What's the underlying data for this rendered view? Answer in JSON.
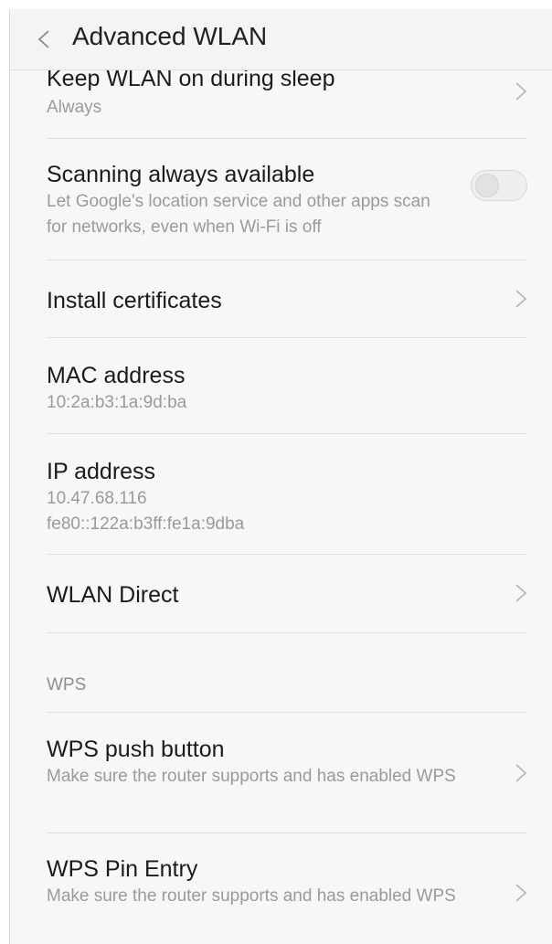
{
  "header": {
    "title": "Advanced WLAN",
    "back_icon": "chevron-left-icon"
  },
  "items": {
    "keep_wlan": {
      "title": "Keep WLAN on during sleep",
      "value": "Always"
    },
    "scanning": {
      "title": "Scanning always available",
      "description": "Let Google's location service and other apps scan for networks, even when Wi-Fi is off",
      "toggle_on": false
    },
    "install_certificates": {
      "title": "Install certificates"
    },
    "mac_address": {
      "title": "MAC address",
      "value": "10:2a:b3:1a:9d:ba"
    },
    "ip_address": {
      "title": "IP address",
      "value_ipv4": "10.47.68.116",
      "value_ipv6": "fe80::122a:b3ff:fe1a:9dba"
    },
    "wlan_direct": {
      "title": "WLAN Direct"
    },
    "wps_section": {
      "label": "WPS"
    },
    "wps_push": {
      "title": "WPS push button",
      "description": "Make sure the router supports and has enabled WPS"
    },
    "wps_pin": {
      "title": "WPS Pin Entry",
      "description": "Make sure the router supports and has enabled WPS"
    }
  },
  "colors": {
    "background": "#f7f7f7",
    "title_text": "#1b1b1b",
    "secondary_text": "#9a9a9a",
    "divider": "#dedede"
  }
}
